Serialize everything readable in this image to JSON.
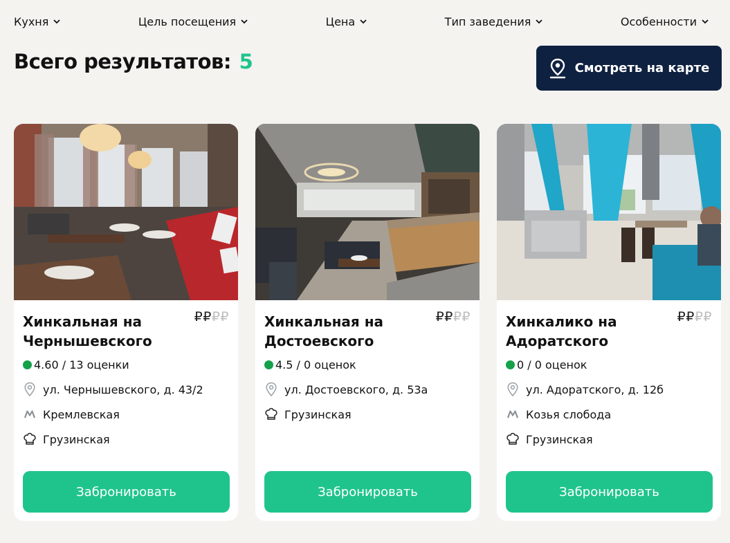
{
  "filters": [
    {
      "label": "Кухня"
    },
    {
      "label": "Цель посещения"
    },
    {
      "label": "Цена"
    },
    {
      "label": "Тип заведения"
    },
    {
      "label": "Особенности"
    }
  ],
  "results": {
    "label": "Всего результатов:",
    "count": "5"
  },
  "map_button": {
    "label": "Смотреть на карте"
  },
  "colors": {
    "accent": "#1fc48c",
    "navy": "#0f2140",
    "rating_dot": "#14a14a",
    "background": "#f4f3f0"
  },
  "cards": [
    {
      "title_line1": "Хинкальная на",
      "title_line2": "Чернышевского",
      "price_active": "₽₽",
      "price_inactive": "₽₽",
      "rating": "4.60 / 13 оценки",
      "address": "ул. Чернышевского, д. 43/2",
      "metro": "Кремлевская",
      "cuisine": "Грузинская",
      "book_label": "Забронировать"
    },
    {
      "title_line1": "Хинкальная на",
      "title_line2": "Достоевского",
      "price_active": "₽₽",
      "price_inactive": "₽₽",
      "rating": "4.5 / 0 оценок",
      "address": "ул. Достоевского, д. 53а",
      "cuisine": "Грузинская",
      "book_label": "Забронировать"
    },
    {
      "title_line1": "Хинкалико на",
      "title_line2": "Адоратского",
      "price_active": "₽₽",
      "price_inactive": "₽₽",
      "rating": "0 / 0 оценок",
      "address": "ул. Адоратского, д. 12б",
      "metro": "Козья слобода",
      "cuisine": "Грузинская",
      "book_label": "Забронировать"
    }
  ]
}
